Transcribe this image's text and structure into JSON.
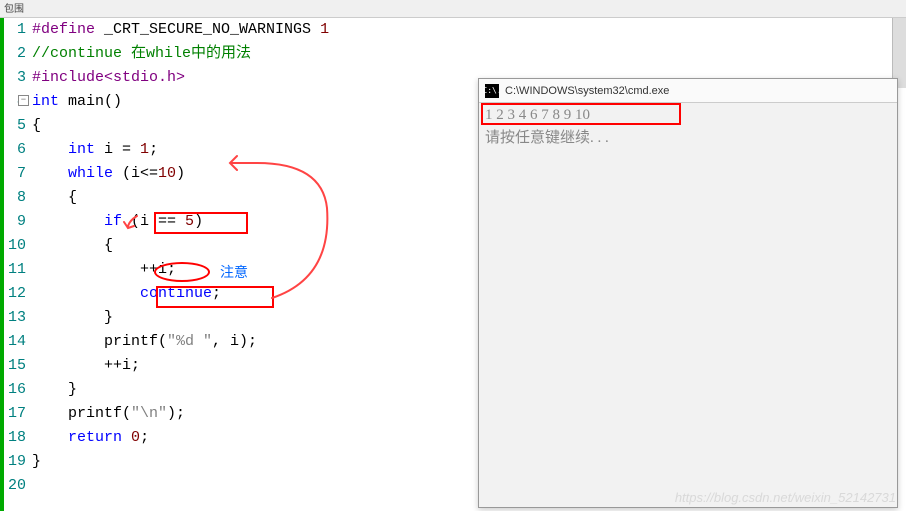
{
  "tab": {
    "label": "包围"
  },
  "line_numbers": [
    "1",
    "2",
    "3",
    "4",
    "5",
    "6",
    "7",
    "8",
    "9",
    "10",
    "11",
    "12",
    "13",
    "14",
    "15",
    "16",
    "17",
    "18",
    "19",
    "20"
  ],
  "code": {
    "l1": {
      "define": "#define",
      "macro": " _CRT_SECURE_NO_WARNINGS ",
      "val": "1"
    },
    "l2": {
      "comment": "//continue 在while中的用法"
    },
    "l3": {
      "include": "#include",
      "hdr": "<stdio.h>"
    },
    "l4": {
      "kw": "int",
      "fn": " main()"
    },
    "l5": {
      "brace": "{"
    },
    "l6": {
      "indent": "    ",
      "kw": "int",
      "rest": " i = ",
      "num": "1",
      "semi": ";"
    },
    "l7": {
      "indent": "    ",
      "kw": "while",
      "cond": " (i<=",
      "num": "10",
      "close": ")"
    },
    "l8": {
      "indent": "    ",
      "brace": "{"
    },
    "l9": {
      "indent": "        ",
      "kw": "if",
      "cond": " (i == ",
      "num": "5",
      "close": ")"
    },
    "l10": {
      "indent": "        ",
      "brace": "{"
    },
    "l11": {
      "indent": "            ",
      "stmt": "++i;"
    },
    "l12": {
      "indent": "            ",
      "kw": "continue",
      "semi": ";"
    },
    "l13": {
      "indent": "        ",
      "brace": "}"
    },
    "l14": {
      "indent": "        ",
      "fn": "printf(",
      "str": "\"%d \"",
      "rest": ", i);"
    },
    "l15": {
      "indent": "        ",
      "stmt": "++i;"
    },
    "l16": {
      "indent": "    ",
      "brace": "}"
    },
    "l17": {
      "indent": "    ",
      "fn": "printf(",
      "str": "\"\\n\"",
      "rest": ");"
    },
    "l18": {
      "indent": "    ",
      "kw": "return",
      "sp": " ",
      "num": "0",
      "semi": ";"
    },
    "l19": {
      "brace": "}"
    }
  },
  "annotation": {
    "note": "注意"
  },
  "console": {
    "title": "C:\\WINDOWS\\system32\\cmd.exe",
    "icon_text": "C:\\.",
    "output": "1 2 3 4 6 7 8 9 10",
    "prompt": "请按任意键继续. . ."
  },
  "watermark": "https://blog.csdn.net/weixin_52142731"
}
